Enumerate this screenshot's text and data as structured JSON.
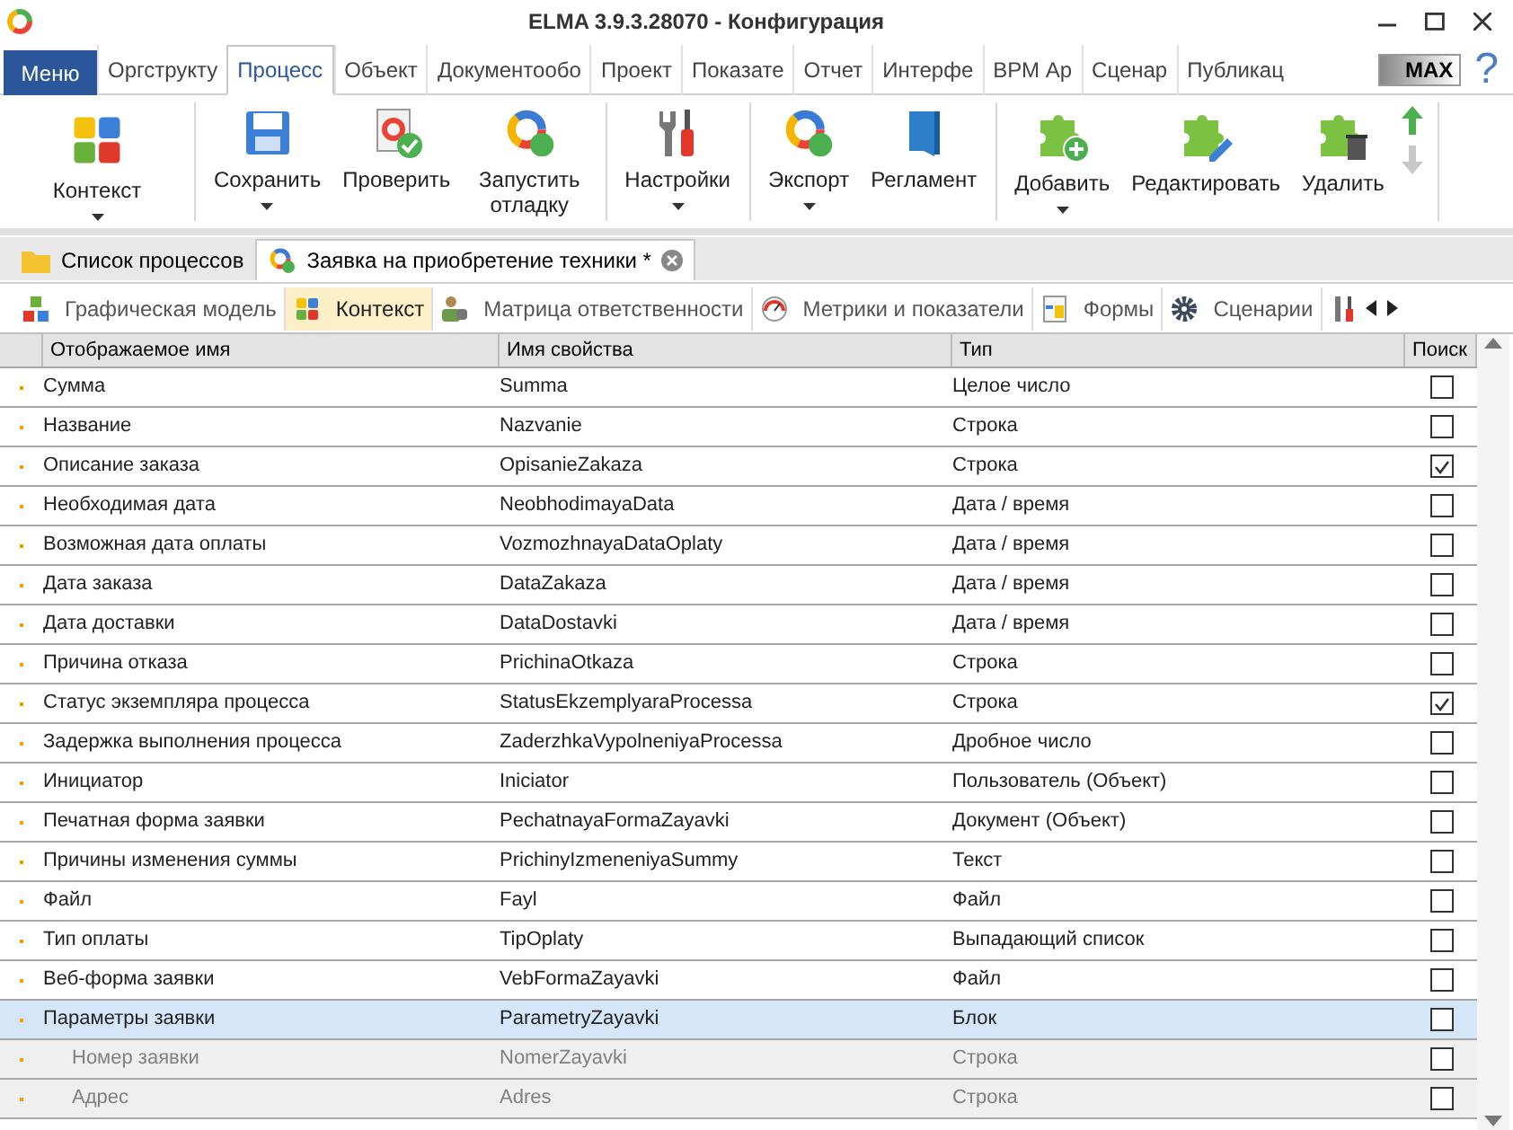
{
  "window": {
    "title": "ELMA 3.9.3.28070 - Конфигурация"
  },
  "menu_button": "Меню",
  "ribbon_tabs": [
    {
      "label": "Оргструкту",
      "selected": false
    },
    {
      "label": "Процесс",
      "selected": true
    },
    {
      "label": "Объект",
      "selected": false
    },
    {
      "label": "Документообо",
      "selected": false
    },
    {
      "label": "Проект",
      "selected": false
    },
    {
      "label": "Показате",
      "selected": false
    },
    {
      "label": "Отчет",
      "selected": false
    },
    {
      "label": "Интерфе",
      "selected": false
    },
    {
      "label": "ВРМ Ар",
      "selected": false
    },
    {
      "label": "Сценар",
      "selected": false
    },
    {
      "label": "Публикац",
      "selected": false
    }
  ],
  "max_badge": "MAX",
  "help": "?",
  "toolbar_groups": [
    {
      "buttons": [
        {
          "kind": "puzzle",
          "label": "Контекст",
          "dropdown": true
        }
      ]
    },
    {
      "buttons": [
        {
          "kind": "save",
          "label": "Сохранить",
          "dropdown": true
        },
        {
          "kind": "check",
          "label": "Проверить",
          "dropdown": false
        },
        {
          "kind": "run",
          "label": "Запустить отладку",
          "dropdown": false
        }
      ]
    },
    {
      "buttons": [
        {
          "kind": "tools",
          "label": "Настройки",
          "dropdown": true
        }
      ]
    },
    {
      "buttons": [
        {
          "kind": "export",
          "label": "Экспорт",
          "dropdown": true
        },
        {
          "kind": "book",
          "label": "Регламент",
          "dropdown": false
        }
      ]
    },
    {
      "buttons": [
        {
          "kind": "add",
          "label": "Добавить",
          "dropdown": true
        },
        {
          "kind": "edit",
          "label": "Редактировать",
          "dropdown": false
        },
        {
          "kind": "delete",
          "label": "Удалить",
          "dropdown": false
        }
      ]
    }
  ],
  "move_buttons": [
    {
      "kind": "up",
      "disabled": false
    },
    {
      "kind": "down",
      "disabled": true
    }
  ],
  "document_tabs": [
    {
      "kind": "folder",
      "label": "Список процессов",
      "selected": false,
      "closable": false
    },
    {
      "kind": "process",
      "label": "Заявка на приобретение техники *",
      "selected": true,
      "closable": true
    }
  ],
  "sub_tabs": [
    {
      "kind": "graph",
      "label": "Графическая модель",
      "selected": false
    },
    {
      "kind": "puzzle",
      "label": "Контекст",
      "selected": true
    },
    {
      "kind": "matrix",
      "label": "Матрица ответственности",
      "selected": false
    },
    {
      "kind": "gauge",
      "label": "Метрики и показатели",
      "selected": false
    },
    {
      "kind": "form",
      "label": "Формы",
      "selected": false
    },
    {
      "kind": "gear",
      "label": "Сценарии",
      "selected": false
    }
  ],
  "table": {
    "columns": [
      "Отображаемое имя",
      "Имя свойства",
      "Тип",
      "Поиск"
    ],
    "rows": [
      {
        "name": "Сумма",
        "property": "Summa",
        "type": "Целое число",
        "search": false,
        "selected": false
      },
      {
        "name": "Название",
        "property": "Nazvanie",
        "type": "Строка",
        "search": false,
        "selected": false
      },
      {
        "name": "Описание заказа",
        "property": "OpisanieZakaza",
        "type": "Строка",
        "search": true,
        "selected": false
      },
      {
        "name": "Необходимая дата",
        "property": "NeobhodimayaData",
        "type": "Дата / время",
        "search": false,
        "selected": false
      },
      {
        "name": "Возможная дата оплаты",
        "property": "VozmozhnayaDataOplaty",
        "type": "Дата / время",
        "search": false,
        "selected": false
      },
      {
        "name": "Дата заказа",
        "property": "DataZakaza",
        "type": "Дата / время",
        "search": false,
        "selected": false
      },
      {
        "name": "Дата доставки",
        "property": "DataDostavki",
        "type": "Дата / время",
        "search": false,
        "selected": false
      },
      {
        "name": "Причина отказа",
        "property": "PrichinaOtkaza",
        "type": "Строка",
        "search": false,
        "selected": false
      },
      {
        "name": "Статус экземпляра процесса",
        "property": "StatusEkzemplyaraProcessa",
        "type": "Строка",
        "search": true,
        "selected": false
      },
      {
        "name": "Задержка выполнения процесса",
        "property": "ZaderzhkaVypolneniyaProcessa",
        "type": "Дробное число",
        "search": false,
        "selected": false
      },
      {
        "name": "Инициатор",
        "property": "Iniciator",
        "type": "Пользователь (Объект)",
        "search": false,
        "selected": false
      },
      {
        "name": "Печатная форма заявки",
        "property": "PechatnayaFormaZayavki",
        "type": "Документ (Объект)",
        "search": false,
        "selected": false
      },
      {
        "name": "Причины изменения суммы",
        "property": "PrichinyIzmeneniyaSummy",
        "type": "Текст",
        "search": false,
        "selected": false
      },
      {
        "name": "Файл",
        "property": "Fayl",
        "type": "Файл",
        "search": false,
        "selected": false
      },
      {
        "name": "Тип оплаты",
        "property": "TipOplaty",
        "type": "Выпадающий список",
        "search": false,
        "selected": false
      },
      {
        "name": "Веб-форма заявки",
        "property": "VebFormaZayavki",
        "type": "Файл",
        "search": false,
        "selected": false
      },
      {
        "name": "Параметры заявки",
        "property": "ParametryZayavki",
        "type": "Блок",
        "search": false,
        "selected": true,
        "children": [
          {
            "name": "Номер заявки",
            "property": "NomerZayavki",
            "type": "Строка",
            "search": false,
            "selected": false
          },
          {
            "name": "Адрес",
            "property": "Adres",
            "type": "Строка",
            "search": false,
            "selected": false
          }
        ]
      }
    ]
  }
}
